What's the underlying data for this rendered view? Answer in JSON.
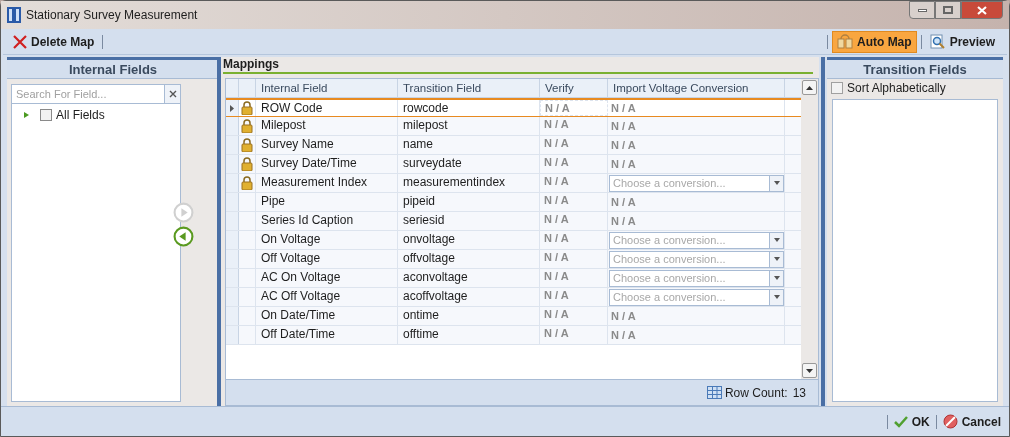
{
  "window": {
    "title": "Stationary Survey Measurement"
  },
  "toolbar": {
    "left": [
      {
        "label": "Delete Map",
        "kind": "delete"
      }
    ],
    "right": [
      {
        "label": "Auto Map",
        "kind": "automap",
        "selected": true
      },
      {
        "label": "Preview",
        "kind": "preview",
        "selected": false
      }
    ]
  },
  "internal_fields": {
    "title": "Internal Fields",
    "search": {
      "placeholder": "Search For Field..."
    },
    "tree": [
      {
        "label": "All Fields",
        "checked": false,
        "expanded": false
      }
    ]
  },
  "move_buttons": [
    {
      "kind": "right",
      "disabled": true
    },
    {
      "kind": "left",
      "disabled": false
    }
  ],
  "mappings": {
    "title": "Mappings",
    "columns": [
      "Internal Field",
      "Transition Field",
      "Verify",
      "Import Voltage Conversion"
    ],
    "rows": [
      {
        "selected": true,
        "locked": true,
        "internal": "ROW Code",
        "transition": "rowcode",
        "verify": "N / A",
        "conversion": {
          "kind": "text",
          "text": "N / A"
        }
      },
      {
        "selected": false,
        "locked": true,
        "internal": "Milepost",
        "transition": "milepost",
        "verify": "N / A",
        "conversion": {
          "kind": "text",
          "text": "N / A"
        }
      },
      {
        "selected": false,
        "locked": true,
        "internal": "Survey Name",
        "transition": "name",
        "verify": "N / A",
        "conversion": {
          "kind": "text",
          "text": "N / A"
        }
      },
      {
        "selected": false,
        "locked": true,
        "internal": "Survey Date/Time",
        "transition": "surveydate",
        "verify": "N / A",
        "conversion": {
          "kind": "text",
          "text": "N / A"
        }
      },
      {
        "selected": false,
        "locked": true,
        "internal": "Measurement Index",
        "transition": "measurementindex",
        "verify": "N / A",
        "conversion": {
          "kind": "dropdown",
          "placeholder": "Choose a conversion..."
        }
      },
      {
        "selected": false,
        "locked": false,
        "internal": "Pipe",
        "transition": "pipeid",
        "verify": "N / A",
        "conversion": {
          "kind": "text",
          "text": "N / A"
        }
      },
      {
        "selected": false,
        "locked": false,
        "internal": "Series Id Caption",
        "transition": "seriesid",
        "verify": "N / A",
        "conversion": {
          "kind": "text",
          "text": "N / A"
        }
      },
      {
        "selected": false,
        "locked": false,
        "internal": "On Voltage",
        "transition": "onvoltage",
        "verify": "N / A",
        "conversion": {
          "kind": "dropdown",
          "placeholder": "Choose a conversion..."
        }
      },
      {
        "selected": false,
        "locked": false,
        "internal": "Off Voltage",
        "transition": "offvoltage",
        "verify": "N / A",
        "conversion": {
          "kind": "dropdown",
          "placeholder": "Choose a conversion..."
        }
      },
      {
        "selected": false,
        "locked": false,
        "internal": "AC On Voltage",
        "transition": "aconvoltage",
        "verify": "N / A",
        "conversion": {
          "kind": "dropdown",
          "placeholder": "Choose a conversion..."
        }
      },
      {
        "selected": false,
        "locked": false,
        "internal": "AC Off Voltage",
        "transition": "acoffvoltage",
        "verify": "N / A",
        "conversion": {
          "kind": "dropdown",
          "placeholder": "Choose a conversion..."
        }
      },
      {
        "selected": false,
        "locked": false,
        "internal": "On Date/Time",
        "transition": "ontime",
        "verify": "N / A",
        "conversion": {
          "kind": "text",
          "text": "N / A"
        }
      },
      {
        "selected": false,
        "locked": false,
        "internal": "Off Date/Time",
        "transition": "offtime",
        "verify": "N / A",
        "conversion": {
          "kind": "text",
          "text": "N / A"
        }
      }
    ],
    "row_count": {
      "label": "Row Count:",
      "value": "13"
    }
  },
  "transition_fields": {
    "title": "Transition Fields",
    "sort": {
      "label": "Sort Alphabetically",
      "checked": false
    }
  },
  "buttons": [
    {
      "label": "OK",
      "kind": "ok"
    },
    {
      "label": "Cancel",
      "kind": "cancel"
    }
  ]
}
